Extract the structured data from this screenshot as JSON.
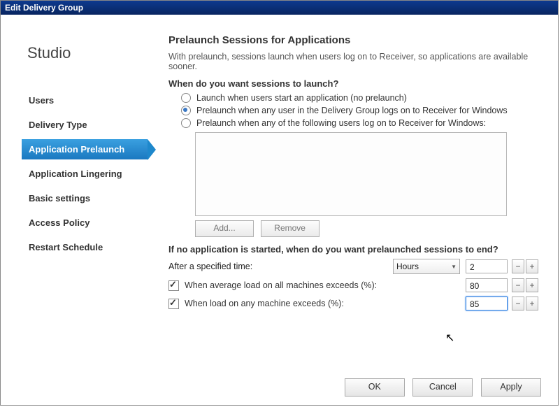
{
  "window": {
    "title": "Edit Delivery Group"
  },
  "sidebar": {
    "brand": "Studio",
    "items": [
      {
        "label": "Users"
      },
      {
        "label": "Delivery Type"
      },
      {
        "label": "Application Prelaunch"
      },
      {
        "label": "Application Lingering"
      },
      {
        "label": "Basic settings"
      },
      {
        "label": "Access Policy"
      },
      {
        "label": "Restart Schedule"
      }
    ],
    "active_index": 2
  },
  "main": {
    "title": "Prelaunch Sessions for Applications",
    "intro": "With prelaunch, sessions launch when users log on to Receiver, so applications are available sooner.",
    "q_launch": "When do you want sessions to launch?",
    "radios": [
      {
        "label": "Launch when users start an application (no prelaunch)",
        "checked": false
      },
      {
        "label": "Prelaunch when any user in the Delivery Group logs on to Receiver for Windows",
        "checked": true
      },
      {
        "label": "Prelaunch when any of the following users log on to Receiver for Windows:",
        "checked": false
      }
    ],
    "list_buttons": {
      "add": "Add...",
      "remove": "Remove"
    },
    "q_end": "If no application is started, when do you want prelaunched sessions to end?",
    "after_time_label": "After a specified time:",
    "time_unit": "Hours",
    "time_value": "2",
    "avg_load": {
      "label": "When average load on all machines exceeds (%):",
      "checked": true,
      "value": "80"
    },
    "any_load": {
      "label": "When load on any machine exceeds (%):",
      "checked": true,
      "value": "85"
    }
  },
  "footer": {
    "ok": "OK",
    "cancel": "Cancel",
    "apply": "Apply"
  }
}
